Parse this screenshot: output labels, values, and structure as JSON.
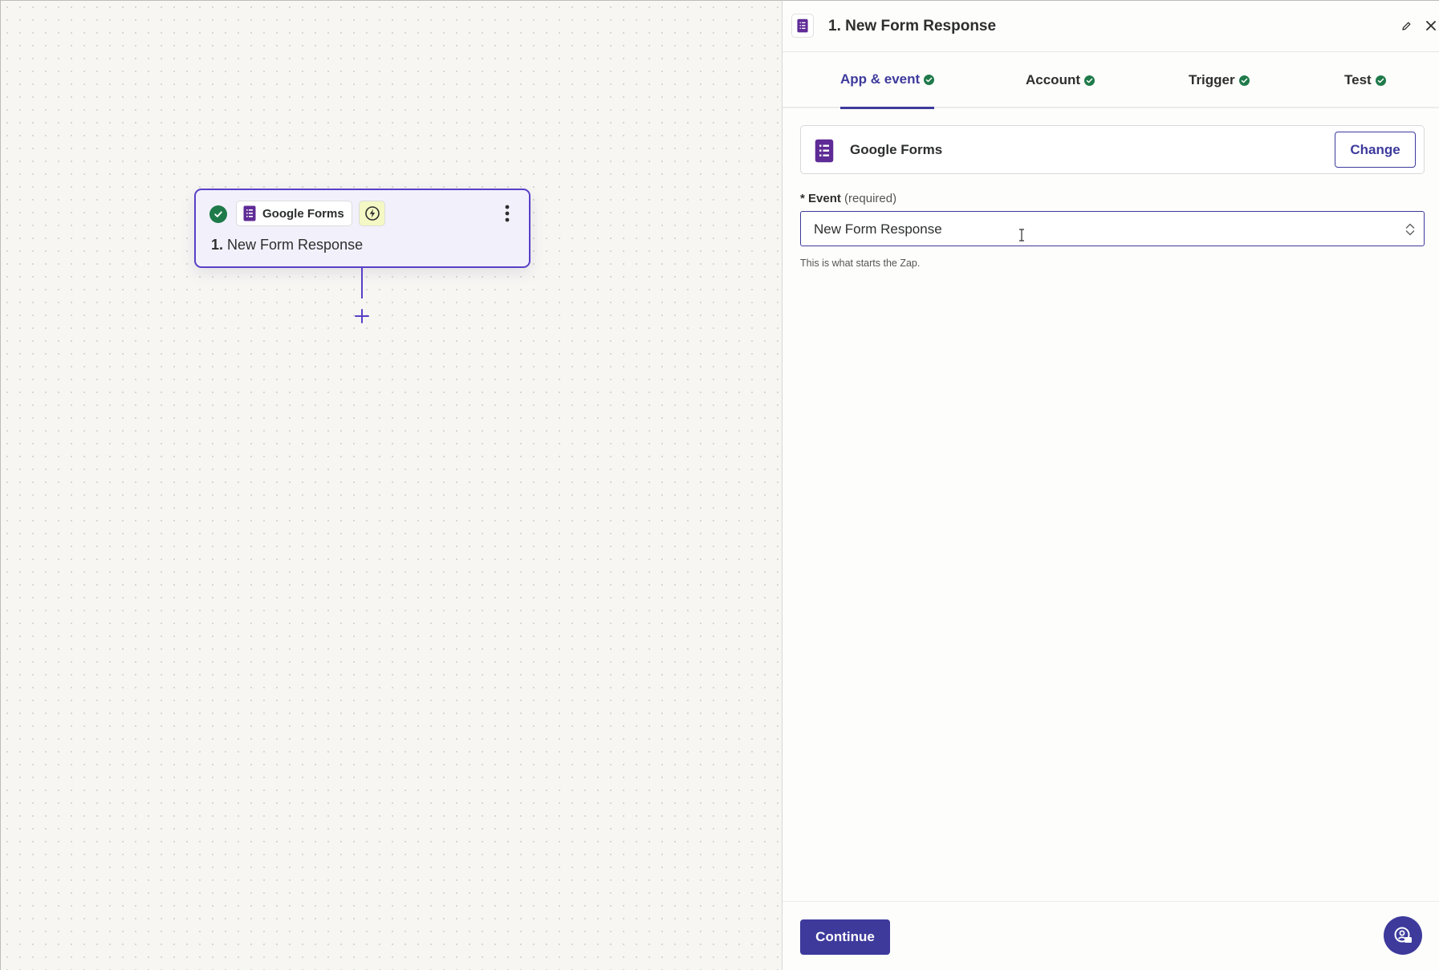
{
  "canvas": {
    "node": {
      "app_name": "Google Forms",
      "step_number": "1.",
      "step_title": "New Form Response",
      "icons": [
        "check-circle-icon",
        "google-forms-icon",
        "lightning-icon",
        "more-vertical-icon"
      ]
    },
    "add_step_icon": "plus-icon"
  },
  "panel": {
    "title": "1. New Form Response",
    "header_icons": [
      "google-forms-icon",
      "pencil-icon",
      "close-icon"
    ],
    "tabs": [
      {
        "label": "App & event",
        "active": true,
        "status": "complete"
      },
      {
        "label": "Account",
        "active": false,
        "status": "complete"
      },
      {
        "label": "Trigger",
        "active": false,
        "status": "complete"
      },
      {
        "label": "Test",
        "active": false,
        "status": "complete"
      }
    ],
    "app": {
      "name": "Google Forms",
      "change_label": "Change"
    },
    "event_field": {
      "required_mark": "*",
      "label": "Event",
      "required_text": "(required)",
      "value": "New Form Response",
      "help_text": "This is what starts the Zap."
    },
    "footer": {
      "continue_label": "Continue",
      "help_icon": "help-chat-icon"
    }
  },
  "colors": {
    "accent": "#3d3a9c",
    "node_border": "#5a3fc8",
    "success": "#1f7a4a",
    "forms_purple": "#5f2b96"
  }
}
